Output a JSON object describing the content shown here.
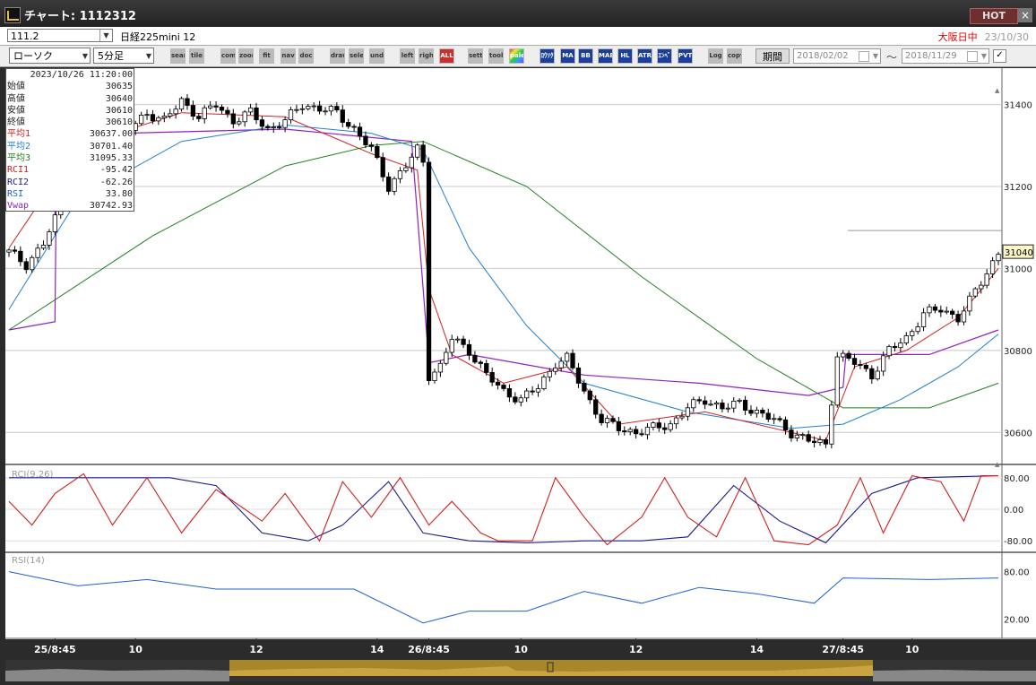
{
  "window": {
    "title": "チャート: 1112312",
    "hot_label": "HOT",
    "close_label": "×"
  },
  "infobar": {
    "code": "111.2",
    "symbol": "日経225mini 12",
    "market": "大阪日中",
    "date": "23/10/30"
  },
  "toolbar": {
    "chart_type": "ローソク",
    "interval": "5分足",
    "period_label": "期間",
    "date_from": "2018/02/02",
    "date_to": "2018/11/29",
    "range_sep": "～",
    "buttons": [
      "search",
      "tile",
      "compare",
      "zoom",
      "fit",
      "nav",
      "doc",
      "draw",
      "select",
      "undo",
      "left",
      "right",
      "ALL",
      "settings",
      "tool",
      "palette",
      "ﾛｳｿｸ",
      "MA",
      "BB",
      "MAE",
      "HL",
      "ATR",
      "ｴﾝﾍﾞ",
      "PVT",
      "Log",
      "copy"
    ]
  },
  "readout": {
    "datetime": "2023/10/26  11:20:00",
    "rows": [
      {
        "label": "始値",
        "value": "30635",
        "color": "#222222"
      },
      {
        "label": "高値",
        "value": "30640",
        "color": "#222222"
      },
      {
        "label": "安値",
        "value": "30610",
        "color": "#222222"
      },
      {
        "label": "終値",
        "value": "30610",
        "color": "#222222"
      },
      {
        "label": "平均1",
        "value": "30637.00",
        "color": "#d02020"
      },
      {
        "label": "平均2",
        "value": "30701.40",
        "color": "#2080d0"
      },
      {
        "label": "平均3",
        "value": "31095.33",
        "color": "#208020"
      },
      {
        "label": "RCI1",
        "value": "-95.42",
        "color": "#d02020"
      },
      {
        "label": "RCI2",
        "value": "-62.26",
        "color": "#1a1a8a"
      },
      {
        "label": "RSI",
        "value": "33.80",
        "color": "#2060d0"
      },
      {
        "label": "Vwap",
        "value": "30742.93",
        "color": "#9020c0"
      }
    ]
  },
  "colors": {
    "candle_up": "#ffffff",
    "candle_down": "#000000",
    "ma1": "#d02020",
    "ma2": "#2080d0",
    "ma3": "#208020",
    "vwap": "#9020c0",
    "rci1": "#d02020",
    "rci2": "#1a1a8a",
    "rsi": "#2060d0"
  },
  "chart_data": [
    {
      "type": "candlestick",
      "title": "",
      "x_ticks": [
        "25/8:45",
        "10",
        "12",
        "14",
        "26/8:45",
        "10",
        "12",
        "14",
        "27/8:45",
        "10"
      ],
      "y_ticks": [
        31400,
        31200,
        31000,
        30800,
        30600
      ],
      "ylim": [
        30535,
        31480
      ],
      "current_price": "31040",
      "close_path": [
        [
          0,
          31040
        ],
        [
          3,
          31010
        ],
        [
          6,
          31060
        ],
        [
          9,
          31150
        ],
        [
          12,
          31320
        ],
        [
          15,
          31360
        ],
        [
          18,
          31370
        ],
        [
          21,
          31340
        ],
        [
          24,
          31380
        ],
        [
          27,
          31360
        ],
        [
          30,
          31410
        ],
        [
          33,
          31370
        ],
        [
          36,
          31400
        ],
        [
          39,
          31360
        ],
        [
          42,
          31380
        ],
        [
          45,
          31340
        ],
        [
          48,
          31360
        ],
        [
          51,
          31400
        ],
        [
          54,
          31390
        ],
        [
          57,
          31380
        ],
        [
          60,
          31340
        ],
        [
          63,
          31290
        ],
        [
          66,
          31200
        ],
        [
          69,
          31250
        ],
        [
          71,
          31290
        ],
        [
          72,
          31260
        ],
        [
          73,
          30740
        ],
        [
          75,
          30760
        ],
        [
          77,
          30830
        ],
        [
          80,
          30800
        ],
        [
          83,
          30740
        ],
        [
          86,
          30700
        ],
        [
          89,
          30680
        ],
        [
          92,
          30710
        ],
        [
          95,
          30770
        ],
        [
          97,
          30780
        ],
        [
          100,
          30700
        ],
        [
          103,
          30630
        ],
        [
          106,
          30610
        ],
        [
          109,
          30600
        ],
        [
          112,
          30610
        ],
        [
          115,
          30620
        ],
        [
          118,
          30660
        ],
        [
          121,
          30680
        ],
        [
          124,
          30660
        ],
        [
          127,
          30670
        ],
        [
          130,
          30650
        ],
        [
          133,
          30630
        ],
        [
          136,
          30600
        ],
        [
          139,
          30580
        ],
        [
          142,
          30570
        ],
        [
          144,
          30790
        ],
        [
          147,
          30770
        ],
        [
          150,
          30740
        ],
        [
          153,
          30800
        ],
        [
          156,
          30830
        ],
        [
          159,
          30890
        ],
        [
          162,
          30900
        ],
        [
          165,
          30880
        ],
        [
          167,
          30920
        ],
        [
          170,
          30990
        ],
        [
          172,
          31040
        ]
      ],
      "ma1": [
        [
          0,
          31050
        ],
        [
          12,
          31300
        ],
        [
          30,
          31380
        ],
        [
          48,
          31370
        ],
        [
          63,
          31280
        ],
        [
          71,
          31240
        ],
        [
          73,
          30950
        ],
        [
          77,
          30790
        ],
        [
          86,
          30720
        ],
        [
          97,
          30760
        ],
        [
          106,
          30620
        ],
        [
          121,
          30650
        ],
        [
          136,
          30600
        ],
        [
          142,
          30580
        ],
        [
          147,
          30760
        ],
        [
          156,
          30800
        ],
        [
          165,
          30880
        ],
        [
          172,
          31000
        ]
      ],
      "ma2": [
        [
          0,
          30900
        ],
        [
          12,
          31170
        ],
        [
          30,
          31310
        ],
        [
          48,
          31350
        ],
        [
          63,
          31330
        ],
        [
          72,
          31290
        ],
        [
          80,
          31050
        ],
        [
          90,
          30860
        ],
        [
          100,
          30720
        ],
        [
          118,
          30650
        ],
        [
          136,
          30610
        ],
        [
          145,
          30620
        ],
        [
          155,
          30680
        ],
        [
          165,
          30760
        ],
        [
          172,
          30840
        ]
      ],
      "ma3": [
        [
          0,
          30850
        ],
        [
          25,
          31080
        ],
        [
          48,
          31250
        ],
        [
          63,
          31300
        ],
        [
          72,
          31310
        ],
        [
          90,
          31200
        ],
        [
          110,
          30980
        ],
        [
          130,
          30780
        ],
        [
          145,
          30660
        ],
        [
          160,
          30660
        ],
        [
          172,
          30720
        ]
      ],
      "vwap": [
        [
          0,
          30850
        ],
        [
          8,
          30870
        ],
        [
          8.3,
          31300
        ],
        [
          20,
          31330
        ],
        [
          48,
          31340
        ],
        [
          70,
          31310
        ],
        [
          73,
          30770
        ],
        [
          80,
          30790
        ],
        [
          100,
          30740
        ],
        [
          120,
          30720
        ],
        [
          139,
          30690
        ],
        [
          145,
          30710
        ],
        [
          145.5,
          30790
        ],
        [
          160,
          30790
        ],
        [
          172,
          30850
        ]
      ]
    },
    {
      "type": "line",
      "title": "RCI(9,26)",
      "ylim": [
        -100,
        100
      ],
      "y_ticks": [
        80,
        0,
        -80
      ],
      "series": [
        {
          "name": "RCI1",
          "values": [
            [
              0,
              20
            ],
            [
              4,
              -40
            ],
            [
              8,
              40
            ],
            [
              13,
              90
            ],
            [
              18,
              -40
            ],
            [
              24,
              80
            ],
            [
              30,
              -60
            ],
            [
              36,
              50
            ],
            [
              44,
              -30
            ],
            [
              48,
              40
            ],
            [
              54,
              -80
            ],
            [
              58,
              70
            ],
            [
              63,
              -20
            ],
            [
              68,
              80
            ],
            [
              73,
              -40
            ],
            [
              77,
              20
            ],
            [
              82,
              -60
            ],
            [
              85,
              -80
            ],
            [
              91,
              -80
            ],
            [
              95,
              80
            ],
            [
              100,
              -20
            ],
            [
              104,
              -90
            ],
            [
              110,
              -20
            ],
            [
              114,
              80
            ],
            [
              118,
              -20
            ],
            [
              123,
              -70
            ],
            [
              128,
              80
            ],
            [
              133,
              -80
            ],
            [
              139,
              -90
            ],
            [
              144,
              -40
            ],
            [
              148,
              80
            ],
            [
              152,
              -60
            ],
            [
              157,
              85
            ],
            [
              162,
              70
            ],
            [
              166,
              -30
            ],
            [
              169,
              85
            ],
            [
              172,
              85
            ]
          ]
        },
        {
          "name": "RCI2",
          "values": [
            [
              0,
              80
            ],
            [
              10,
              80
            ],
            [
              20,
              80
            ],
            [
              28,
              80
            ],
            [
              36,
              60
            ],
            [
              44,
              -60
            ],
            [
              52,
              -80
            ],
            [
              58,
              -40
            ],
            [
              66,
              70
            ],
            [
              72,
              -60
            ],
            [
              80,
              -80
            ],
            [
              90,
              -85
            ],
            [
              100,
              -80
            ],
            [
              110,
              -80
            ],
            [
              118,
              -70
            ],
            [
              126,
              60
            ],
            [
              134,
              -30
            ],
            [
              142,
              -85
            ],
            [
              150,
              40
            ],
            [
              158,
              80
            ],
            [
              172,
              85
            ]
          ]
        }
      ]
    },
    {
      "type": "line",
      "title": "RSI(14)",
      "ylim": [
        0,
        100
      ],
      "y_ticks": [
        80,
        20
      ],
      "series": [
        {
          "name": "RSI",
          "values": [
            [
              0,
              80
            ],
            [
              12,
              62
            ],
            [
              24,
              70
            ],
            [
              36,
              58
            ],
            [
              48,
              58
            ],
            [
              60,
              58
            ],
            [
              72,
              15
            ],
            [
              80,
              30
            ],
            [
              90,
              30
            ],
            [
              100,
              55
            ],
            [
              110,
              40
            ],
            [
              120,
              60
            ],
            [
              130,
              52
            ],
            [
              140,
              40
            ],
            [
              145,
              72
            ],
            [
              160,
              70
            ],
            [
              172,
              72
            ]
          ]
        }
      ]
    }
  ]
}
